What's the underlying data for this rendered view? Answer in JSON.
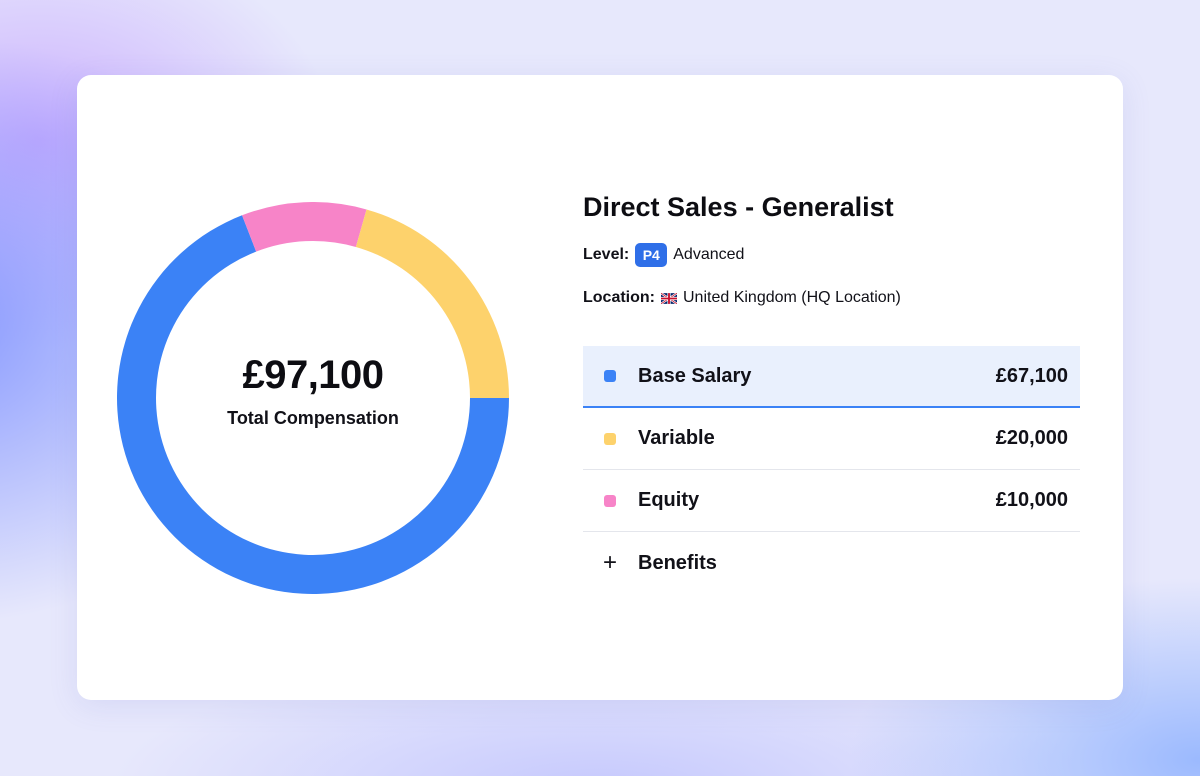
{
  "total": {
    "value": "£97,100",
    "label": "Total Compensation"
  },
  "role": {
    "title": "Direct Sales - Generalist",
    "level_label": "Level:",
    "level_badge": "P4",
    "level_name": "Advanced",
    "location_label": "Location:",
    "location_flag": "uk-flag-icon",
    "location_value": "United Kingdom (HQ Location)"
  },
  "components": [
    {
      "name": "Base Salary",
      "value": "£67,100",
      "color": "#3b82f6",
      "selected": true
    },
    {
      "name": "Variable",
      "value": "£20,000",
      "color": "#fdd26c"
    },
    {
      "name": "Equity",
      "value": "£10,000",
      "color": "#f784c8"
    }
  ],
  "benefits": {
    "label": "Benefits",
    "icon": "plus-icon"
  },
  "chart_data": {
    "type": "pie",
    "categories": [
      "Base Salary",
      "Variable",
      "Equity"
    ],
    "values": [
      67100,
      20000,
      10000
    ],
    "colors": [
      "#3b82f6",
      "#fdd26c",
      "#f784c8"
    ]
  }
}
